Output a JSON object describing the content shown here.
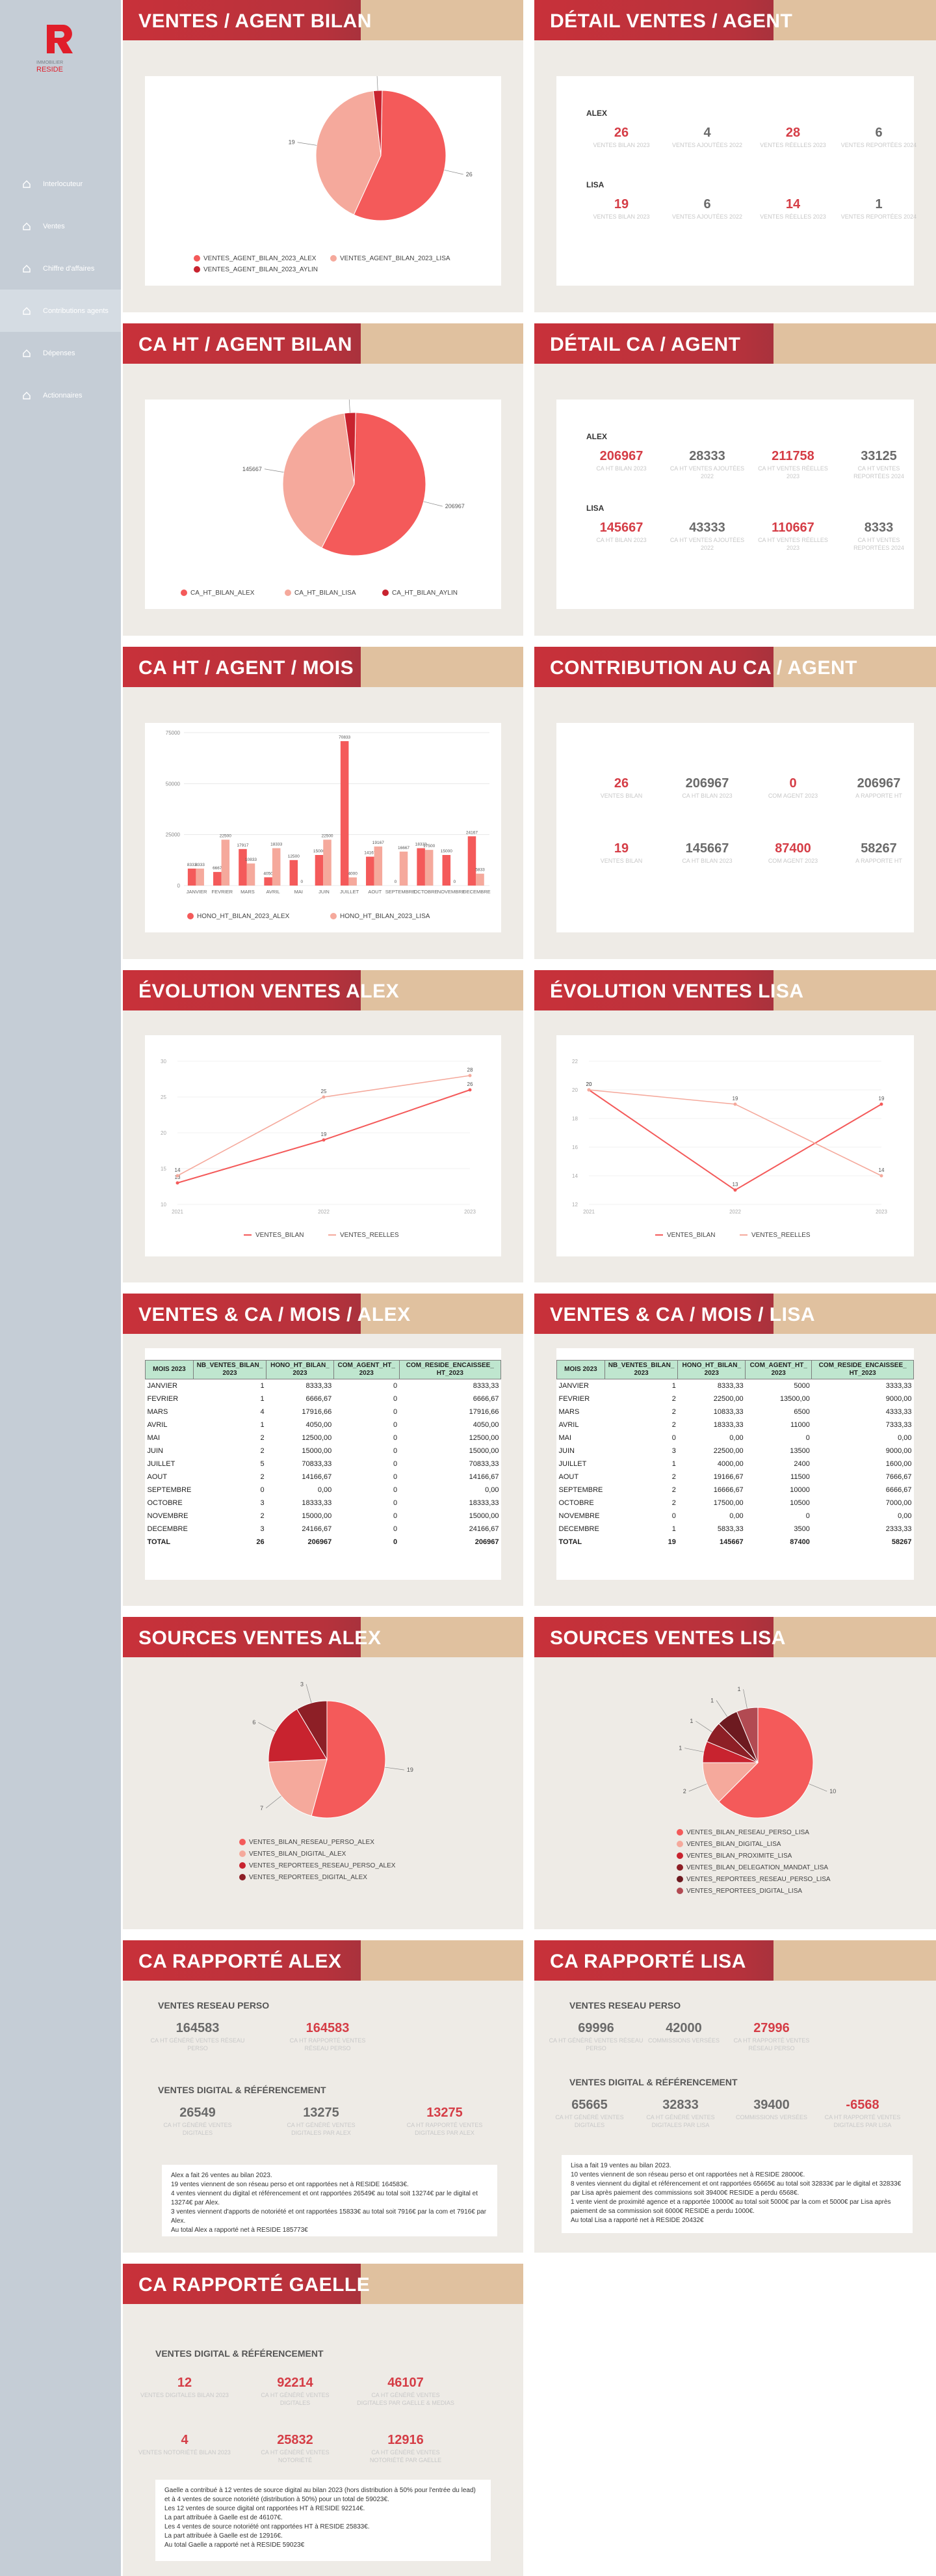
{
  "app": {
    "logo_text": "RESIDE",
    "logo_sub": "IMMOBILIER"
  },
  "nav": [
    {
      "label": "Interlocuteur"
    },
    {
      "label": "Ventes"
    },
    {
      "label": "Chiffre d'affaires"
    },
    {
      "label": "Contributions agents"
    },
    {
      "label": "Dépenses"
    },
    {
      "label": "Actionnaires"
    }
  ],
  "colors": {
    "accent": "#d53d46",
    "header": "#b7323c",
    "pie1": "#f45a5a",
    "pie2": "#f5a99c",
    "pie3": "#c8232f",
    "pie4": "#8d1f26"
  },
  "p1": {
    "title": "VENTES / AGENT BILAN",
    "labels": [
      "1",
      "19",
      "26"
    ],
    "legend": [
      "VENTES_AGENT_BILAN_2023_ALEX",
      "VENTES_AGENT_BILAN_2023_LISA",
      "VENTES_AGENT_BILAN_2023_AYLIN"
    ]
  },
  "p2": {
    "title": "DÉTAIL VENTES / AGENT",
    "agents": [
      {
        "name": "ALEX",
        "v": [
          "26",
          "4",
          "28",
          "6"
        ]
      },
      {
        "name": "LISA",
        "v": [
          "19",
          "6",
          "14",
          "1"
        ]
      }
    ],
    "labels": [
      "VENTES BILAN 2023",
      "VENTES AJOUTÉES 2022",
      "VENTES RÉELLES 2023",
      "VENTES REPORTÉES 2024"
    ]
  },
  "p3": {
    "title": "CA HT / AGENT BILAN",
    "labels": [
      "9166",
      "145667",
      "206967"
    ],
    "legend": [
      "CA_HT_BILAN_ALEX",
      "CA_HT_BILAN_LISA",
      "CA_HT_BILAN_AYLIN"
    ]
  },
  "p4": {
    "title": "DÉTAIL CA / AGENT",
    "agents": [
      {
        "name": "ALEX",
        "v": [
          "206967",
          "28333",
          "211758",
          "33125"
        ]
      },
      {
        "name": "LISA",
        "v": [
          "145667",
          "43333",
          "110667",
          "8333"
        ]
      }
    ],
    "labels": [
      "CA HT BILAN 2023",
      "CA HT VENTES AJOUTÉES 2022",
      "CA HT VENTES RÉELLES 2023",
      "CA HT VENTES REPORTÉES 2024"
    ]
  },
  "p5": {
    "title": "CA HT / AGENT / MOIS",
    "legend": [
      "HONO_HT_BILAN_2023_ALEX",
      "HONO_HT_BILAN_2023_LISA"
    ]
  },
  "p6": {
    "title": "CONTRIBUTION AU CA / AGENT",
    "rows": [
      {
        "v": [
          "26",
          "206967",
          "0",
          "206967"
        ]
      },
      {
        "v": [
          "19",
          "145667",
          "87400",
          "58267"
        ]
      }
    ],
    "labels": [
      "VENTES BILAN",
      "CA HT BILAN 2023",
      "COM AGENT 2023",
      "A RAPPORTE HT"
    ]
  },
  "p7": {
    "title": "ÉVOLUTION VENTES ALEX",
    "legend": [
      "VENTES_BILAN",
      "VENTES_REELLES"
    ]
  },
  "p8": {
    "title": "ÉVOLUTION VENTES LISA",
    "legend": [
      "VENTES_BILAN",
      "VENTES_REELLES"
    ]
  },
  "p9": {
    "title": "VENTES & CA / MOIS / ALEX",
    "cols": [
      "MOIS 2023",
      "NB_VENTES_BILAN_2023",
      "HONO_HT_BILAN_2023",
      "COM_AGENT_HT_2023",
      "COM_RESIDE_ENCAISSEE_HT_2023"
    ],
    "rows": [
      [
        "JANVIER",
        "1",
        "8333,33",
        "0",
        "8333,33"
      ],
      [
        "FEVRIER",
        "1",
        "6666,67",
        "0",
        "6666,67"
      ],
      [
        "MARS",
        "4",
        "17916,66",
        "0",
        "17916,66"
      ],
      [
        "AVRIL",
        "1",
        "4050,00",
        "0",
        "4050,00"
      ],
      [
        "MAI",
        "2",
        "12500,00",
        "0",
        "12500,00"
      ],
      [
        "JUIN",
        "2",
        "15000,00",
        "0",
        "15000,00"
      ],
      [
        "JUILLET",
        "5",
        "70833,33",
        "0",
        "70833,33"
      ],
      [
        "AOUT",
        "2",
        "14166,67",
        "0",
        "14166,67"
      ],
      [
        "SEPTEMBRE",
        "0",
        "0,00",
        "0",
        "0,00"
      ],
      [
        "OCTOBRE",
        "3",
        "18333,33",
        "0",
        "18333,33"
      ],
      [
        "NOVEMBRE",
        "2",
        "15000,00",
        "0",
        "15000,00"
      ],
      [
        "DECEMBRE",
        "3",
        "24166,67",
        "0",
        "24166,67"
      ],
      [
        "TOTAL",
        "26",
        "206967",
        "0",
        "206967"
      ]
    ]
  },
  "p10": {
    "title": "VENTES & CA / MOIS / LISA",
    "cols": [
      "MOIS 2023",
      "NB_VENTES_BILAN_2023",
      "HONO_HT_BILAN_2023",
      "COM_AGENT_HT_2023",
      "COM_RESIDE_ENCAISSEE_HT_2023"
    ],
    "rows": [
      [
        "JANVIER",
        "1",
        "8333,33",
        "5000",
        "3333,33"
      ],
      [
        "FEVRIER",
        "2",
        "22500,00",
        "13500,00",
        "9000,00"
      ],
      [
        "MARS",
        "2",
        "10833,33",
        "6500",
        "4333,33"
      ],
      [
        "AVRIL",
        "2",
        "18333,33",
        "11000",
        "7333,33"
      ],
      [
        "MAI",
        "0",
        "0,00",
        "0",
        "0,00"
      ],
      [
        "JUIN",
        "3",
        "22500,00",
        "13500",
        "9000,00"
      ],
      [
        "JUILLET",
        "1",
        "4000,00",
        "2400",
        "1600,00"
      ],
      [
        "AOUT",
        "2",
        "19166,67",
        "11500",
        "7666,67"
      ],
      [
        "SEPTEMBRE",
        "2",
        "16666,67",
        "10000",
        "6666,67"
      ],
      [
        "OCTOBRE",
        "2",
        "17500,00",
        "10500",
        "7000,00"
      ],
      [
        "NOVEMBRE",
        "0",
        "0,00",
        "0",
        "0,00"
      ],
      [
        "DECEMBRE",
        "1",
        "5833,33",
        "3500",
        "2333,33"
      ],
      [
        "TOTAL",
        "19",
        "145667",
        "87400",
        "58267"
      ]
    ]
  },
  "p11": {
    "title": "SOURCES VENTES ALEX",
    "labels": [
      "3",
      "6",
      "7",
      "19"
    ],
    "legend": [
      "VENTES_BILAN_RESEAU_PERSO_ALEX",
      "VENTES_BILAN_DIGITAL_ALEX",
      "VENTES_REPORTEES_RESEAU_PERSO_ALEX",
      "VENTES_REPORTEES_DIGITAL_ALEX"
    ]
  },
  "p12": {
    "title": "SOURCES VENTES LISA",
    "labels": [
      "1",
      "1",
      "1",
      "1",
      "2",
      "10"
    ],
    "legend": [
      "VENTES_BILAN_RESEAU_PERSO_LISA",
      "VENTES_BILAN_DIGITAL_LISA",
      "VENTES_BILAN_PROXIMITE_LISA",
      "VENTES_BILAN_DELEGATION_MANDAT_LISA",
      "VENTES_REPORTEES_RESEAU_PERSO_LISA",
      "VENTES_REPORTEES_DIGITAL_LISA"
    ]
  },
  "p13": {
    "title": "CA RAPPORTÉ ALEX",
    "s1": "VENTES RESEAU PERSO",
    "k1": [
      {
        "v": "164583",
        "l": "CA HT GÉNÉRÉ VENTES RÉSEAU PERSO"
      },
      {
        "v": "164583",
        "l": "CA HT RAPPORTÉ VENTES RÉSEAU PERSO"
      }
    ],
    "s2": "VENTES DIGITAL & RÉFÉRENCEMENT",
    "k2": [
      {
        "v": "26549",
        "l": "CA HT GÉNÉRÉ VENTES DIGITALES"
      },
      {
        "v": "13275",
        "l": "CA HT GÉNÉRÉ VENTES DIGITALES PAR ALEX"
      },
      {
        "v": "13275",
        "l": "CA HT RAPPORTÉ VENTES DIGITALES PAR ALEX"
      }
    ],
    "note": [
      "Alex a fait 26 ventes au bilan 2023.",
      "19 ventes viennent de son réseau perso et ont rapportées net à RESIDE 164583€.",
      "4 ventes viennent du digital et référencement et ont rapportées 26549€ au total soit 13274€ par le digital et 13274€ par Alex.",
      "3 ventes viennent d'apports de notoriété et ont rapportées 15833€ au total soit 7916€ par la com et 7916€ par Alex.",
      "Au total Alex a rapporté net à RESIDE 185773€"
    ]
  },
  "p14": {
    "title": "CA RAPPORTÉ LISA",
    "s1": "VENTES RESEAU PERSO",
    "k1": [
      {
        "v": "69996",
        "l": "CA HT GÉNÉRÉ VENTES RÉSEAU PERSO"
      },
      {
        "v": "42000",
        "l": "COMMISSIONS VERSÉES"
      },
      {
        "v": "27996",
        "l": "CA HT RAPPORTÉ VENTES RÉSEAU PERSO"
      }
    ],
    "s2": "VENTES DIGITAL & RÉFÉRENCEMENT",
    "k2": [
      {
        "v": "65665",
        "l": "CA HT GÉNÉRÉ VENTES DIGITALES"
      },
      {
        "v": "32833",
        "l": "CA HT GÉNÉRÉ VENTES DIGITALES PAR LISA"
      },
      {
        "v": "39400",
        "l": "COMMISSIONS VERSÉES"
      },
      {
        "v": "-6568",
        "l": "CA HT RAPPORTÉ VENTES DIGITALES PAR LISA"
      }
    ],
    "note": [
      "Lisa a fait 19 ventes au bilan 2023.",
      "10 ventes viennent de son réseau perso et ont rapportées net à RESIDE 28000€.",
      "8 ventes viennent du digital et référencement et ont rapportées 65665€ au total soit 32833€ par le digital et 32833€ par Lisa après paiement des commissions soit 39400€ RESIDE a perdu 6568€.",
      "1 vente vient de proximité agence et a rapportée 10000€ au total soit 5000€ par la com et 5000€ par Lisa après paiement de sa commission soit 6000€ RESIDE a perdu 1000€.",
      "Au total Lisa a rapporté net à RESIDE 20432€"
    ]
  },
  "p15": {
    "title": "CA RAPPORTÉ GAELLE",
    "s2": "VENTES DIGITAL & RÉFÉRENCEMENT",
    "k2": [
      {
        "v": "12",
        "l": "VENTES DIGITALES BILAN 2023"
      },
      {
        "v": "92214",
        "l": "CA HT GÉNÉRÉ VENTES DIGITALES"
      },
      {
        "v": "46107",
        "l": "CA HT GÉNÉRÉ VENTES DIGITALES PAR GAELLE & MEDIAS"
      },
      {
        "v": "4",
        "l": "VENTES NOTORIÉTÉ BILAN 2023"
      },
      {
        "v": "25832",
        "l": "CA HT GÉNÉRÉ VENTES NOTORIÉTÉ"
      },
      {
        "v": "12916",
        "l": "CA HT GÉNÉRÉ VENTES NOTORIÉTÉ PAR GAELLE"
      }
    ],
    "note": [
      "Gaelle a contribué à 12 ventes de source digital au bilan 2023 (hors distribution à 50% pour l'entrée du lead) et à 4 ventes de source notoriété (distribution à 50%) pour un total de 59023€.",
      "Les 12 ventes de source digital ont rapportées HT à RESIDE 92214€.",
      "La part attribuée à Gaelle est de 46107€.",
      "Les 4 ventes de source notoriété ont rapportées HT à RESIDE 25833€.",
      "La part attribuée à Gaelle est de 12916€.",
      "Au total Gaelle a rapporté net à RESIDE 59023€"
    ]
  },
  "chart_data": [
    {
      "type": "pie",
      "title": "VENTES / AGENT BILAN",
      "categories": [
        "ALEX",
        "LISA",
        "AYLIN"
      ],
      "values": [
        26,
        19,
        1
      ]
    },
    {
      "type": "pie",
      "title": "CA HT / AGENT BILAN",
      "categories": [
        "ALEX",
        "LISA",
        "AYLIN"
      ],
      "values": [
        206967,
        145667,
        9166
      ]
    },
    {
      "type": "bar",
      "title": "CA HT / AGENT / MOIS",
      "categories": [
        "JANVIER",
        "FEVRIER",
        "MARS",
        "AVRIL",
        "MAI",
        "JUIN",
        "JUILLET",
        "AOUT",
        "SEPTEMBRE",
        "OCTOBRE",
        "NOVEMBRE",
        "DECEMBRE"
      ],
      "ylim": [
        0,
        75000
      ],
      "series": [
        {
          "name": "HONO_HT_BILAN_2023_ALEX",
          "values": [
            8333,
            6667,
            17917,
            4050,
            12500,
            15000,
            70833,
            14167,
            0,
            18333,
            15000,
            24167
          ]
        },
        {
          "name": "HONO_HT_BILAN_2023_LISA",
          "values": [
            8333,
            22500,
            10833,
            18333,
            0,
            22500,
            4000,
            19167,
            16667,
            17500,
            0,
            5833
          ]
        }
      ]
    },
    {
      "type": "line",
      "title": "ÉVOLUTION VENTES ALEX",
      "x": [
        2021,
        2022,
        2023
      ],
      "ylim": [
        10,
        30
      ],
      "series": [
        {
          "name": "VENTES_BILAN",
          "values": [
            13,
            19,
            26
          ]
        },
        {
          "name": "VENTES_REELLES",
          "values": [
            14,
            25,
            28
          ]
        }
      ]
    },
    {
      "type": "line",
      "title": "ÉVOLUTION VENTES LISA",
      "x": [
        2021,
        2022,
        2023
      ],
      "ylim": [
        12,
        22
      ],
      "series": [
        {
          "name": "VENTES_BILAN",
          "values": [
            20,
            13,
            19
          ]
        },
        {
          "name": "VENTES_REELLES",
          "values": [
            20,
            19,
            14
          ]
        }
      ]
    },
    {
      "type": "pie",
      "title": "SOURCES VENTES ALEX",
      "categories": [
        "VENTES_BILAN_RESEAU_PERSO_ALEX",
        "VENTES_BILAN_DIGITAL_ALEX",
        "VENTES_REPORTEES_RESEAU_PERSO_ALEX",
        "VENTES_REPORTEES_DIGITAL_ALEX"
      ],
      "values": [
        19,
        7,
        6,
        3
      ]
    },
    {
      "type": "pie",
      "title": "SOURCES VENTES LISA",
      "categories": [
        "VENTES_BILAN_RESEAU_PERSO_LISA",
        "VENTES_BILAN_DIGITAL_LISA",
        "VENTES_BILAN_PROXIMITE_LISA",
        "VENTES_BILAN_DELEGATION_MANDAT_LISA",
        "VENTES_REPORTEES_RESEAU_PERSO_LISA",
        "VENTES_REPORTEES_DIGITAL_LISA"
      ],
      "values": [
        10,
        2,
        1,
        1,
        1,
        1
      ]
    }
  ]
}
